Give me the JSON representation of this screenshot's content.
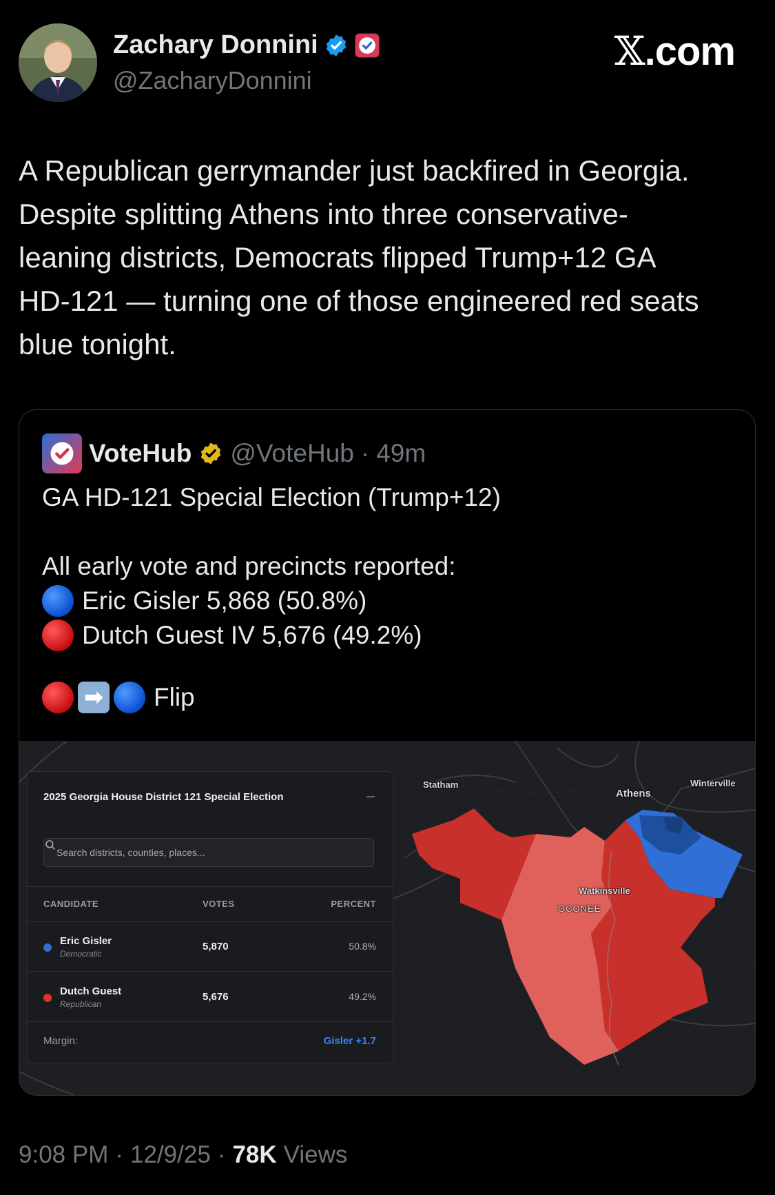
{
  "author": {
    "name": "Zachary Donnini",
    "handle": "@ZacharyDonnini"
  },
  "brand": {
    "site": "com",
    "x_glyph": "𝕏",
    "dot": "."
  },
  "tweet": {
    "lines": [
      "A Republican gerrymander just backfired in Georgia.",
      "Despite splitting Athens into three conservative-",
      "leaning districts, Democrats flipped Trump+12 GA",
      "HD-121 — turning one of those engineered red seats",
      "blue tonight."
    ]
  },
  "quote": {
    "name": "VoteHub",
    "handle": "@VoteHub",
    "sep": "·",
    "time": "49m",
    "title": "GA HD-121 Special Election (Trump+12)",
    "intro": "All early vote and precincts reported:",
    "line1": "Eric Gisler 5,868 (50.8%)",
    "line2": "Dutch Guest IV 5,676 (49.2%)",
    "flip": "Flip",
    "arrow": "➡"
  },
  "panel": {
    "title": "2025 Georgia House District 121 Special Election",
    "minimize": "–",
    "search_placeholder": "Search districts, counties, places...",
    "headers": {
      "candidate": "CANDIDATE",
      "votes": "VOTES",
      "percent": "PERCENT"
    },
    "rows": [
      {
        "name": "Eric Gisler",
        "party": "Democratic",
        "votes": "5,870",
        "percent": "50.8%",
        "color": "#2f6fd6"
      },
      {
        "name": "Dutch Guest",
        "party": "Republican",
        "votes": "5,676",
        "percent": "49.2%",
        "color": "#d9362b"
      }
    ],
    "margin_label": "Margin:",
    "margin_value": "Gisler +1.7"
  },
  "map_labels": {
    "statham": "Statham",
    "athens": "Athens",
    "winterville": "Winterville",
    "watkinsville": "Watkinsville",
    "oconee": "OCONEE"
  },
  "colors": {
    "dem": "#2f6fd6",
    "rep_dark": "#c8312b",
    "rep_light": "#e0605c",
    "dem_strong": "#1e4f9e"
  },
  "footer": {
    "time": "9:08 PM",
    "sep1": "·",
    "date": "12/9/25",
    "sep2": "·",
    "views_count": "78K",
    "views_label": "Views"
  }
}
